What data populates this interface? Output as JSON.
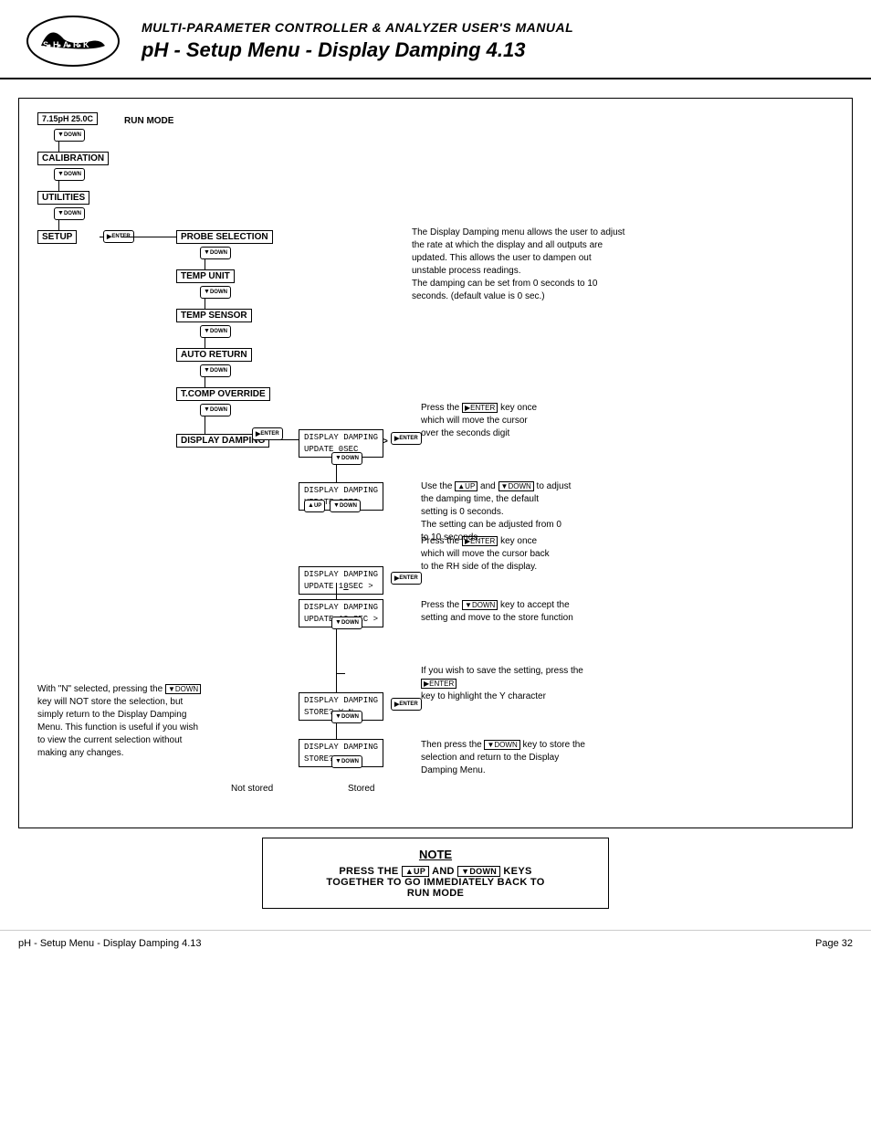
{
  "header": {
    "title1": "MULTI-PARAMETER CONTROLLER & ANALYZER USER'S MANUAL",
    "title2": "pH - Setup Menu - Display Damping 4.13"
  },
  "menu_items": {
    "run_mode": "RUN MODE",
    "reading": "7.15pH  25.0C",
    "calibration": "CALIBRATION",
    "utilities": "UTILITIES",
    "setup": "SETUP",
    "probe_selection": "PROBE SELECTION",
    "temp_unit": "TEMP UNIT",
    "temp_sensor": "TEMP SENSOR",
    "auto_return": "AUTO RETURN",
    "tcomp_override": "T.COMP OVERRIDE",
    "display_damping": "DISPLAY DAMPING",
    "display1_line1": "DISPLAY DAMPING",
    "display1_line2": "UPDATE  0SEC",
    "display2_line1": "DISPLAY DAMPING",
    "display2_line2": "UPDATE  0SEC",
    "display3_line1": "DISPLAY DAMPING",
    "display3_line2": "UPDATE 10SEC",
    "display4_line1": "DISPLAY DAMPING",
    "display4_line2": "UPDATE 1 0SEC",
    "store1_line1": "DISPLAY DAMPING",
    "store1_line2": "STORE?      Y  N",
    "store2_line1": "DISPLAY DAMPING",
    "store2_line2": "STORE?     Y| N"
  },
  "descriptions": {
    "intro": "The Display Damping menu allows the user to adjust\nthe rate at which the display and all outputs are\nupdated. This allows the user to dampen out\nunstable process readings.\nThe damping can be set from 0 seconds to 10\nseconds. (default value is 0 sec.)",
    "press_enter_once": "Press the        key once\nwhich will move the cursor\nover the seconds digit",
    "use_up_down": "Use the       and        to adjust\nthe damping time, the default\nsetting is 0 seconds.\nThe setting can be adjusted from 0\nto 10 seconds.",
    "press_enter_back": "Press the        key once\nwhich will move the cursor back\nto the RH side of the display.",
    "press_down_accept": "Press the        key to accept the\nsetting and move to the store function",
    "save_note": "If you wish to save the setting, press the\nkey to highlight the Y character",
    "not_store_note": "With \"N\" selected, pressing the\nkey will NOT store the selection, but\nsimply return to the Display Damping\nMenu. This function is useful if you wish\nto view the current selection without\nmaking any changes.",
    "not_stored_label": "Not stored",
    "stored_label": "Stored",
    "press_down_store": "Then press the        key to store the\nselection and return to the Display\nDamping Menu."
  },
  "note": {
    "title": "NOTE",
    "text": "PRESS THE        AND        KEYS\nTOGETHER TO GO IMMEDIATELY BACK TO\nRUN MODE"
  },
  "footer": {
    "left": "pH - Setup Menu - Display Damping 4.13",
    "right": "Page 32"
  },
  "buttons": {
    "down_label": "DOWN",
    "up_label": "UP",
    "enter_label": "ENTER"
  }
}
